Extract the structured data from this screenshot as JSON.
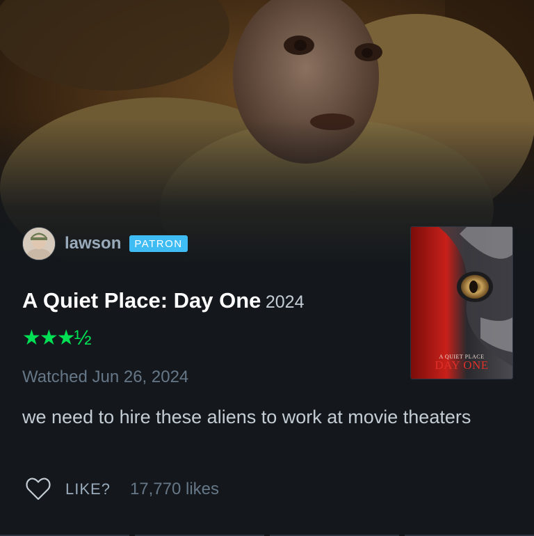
{
  "reviewer": {
    "username": "lawson",
    "badge": "PATRON"
  },
  "film": {
    "title": "A Quiet Place: Day One",
    "year": "2024",
    "poster_text_small": "A QUIET PLACE",
    "poster_text_big": "DAY ONE"
  },
  "review": {
    "rating": "★★★½",
    "rating_stars": 3.5,
    "watched": "Watched Jun 26, 2024",
    "text": "we need to hire these aliens to work at movie theaters"
  },
  "actions": {
    "like_label": "LIKE?",
    "likes_count": "17,770 likes"
  },
  "colors": {
    "background": "#14181c",
    "patron_badge": "#40bcf4",
    "rating_green": "#00e054"
  },
  "icons": {
    "like": "heart-outline-icon"
  }
}
